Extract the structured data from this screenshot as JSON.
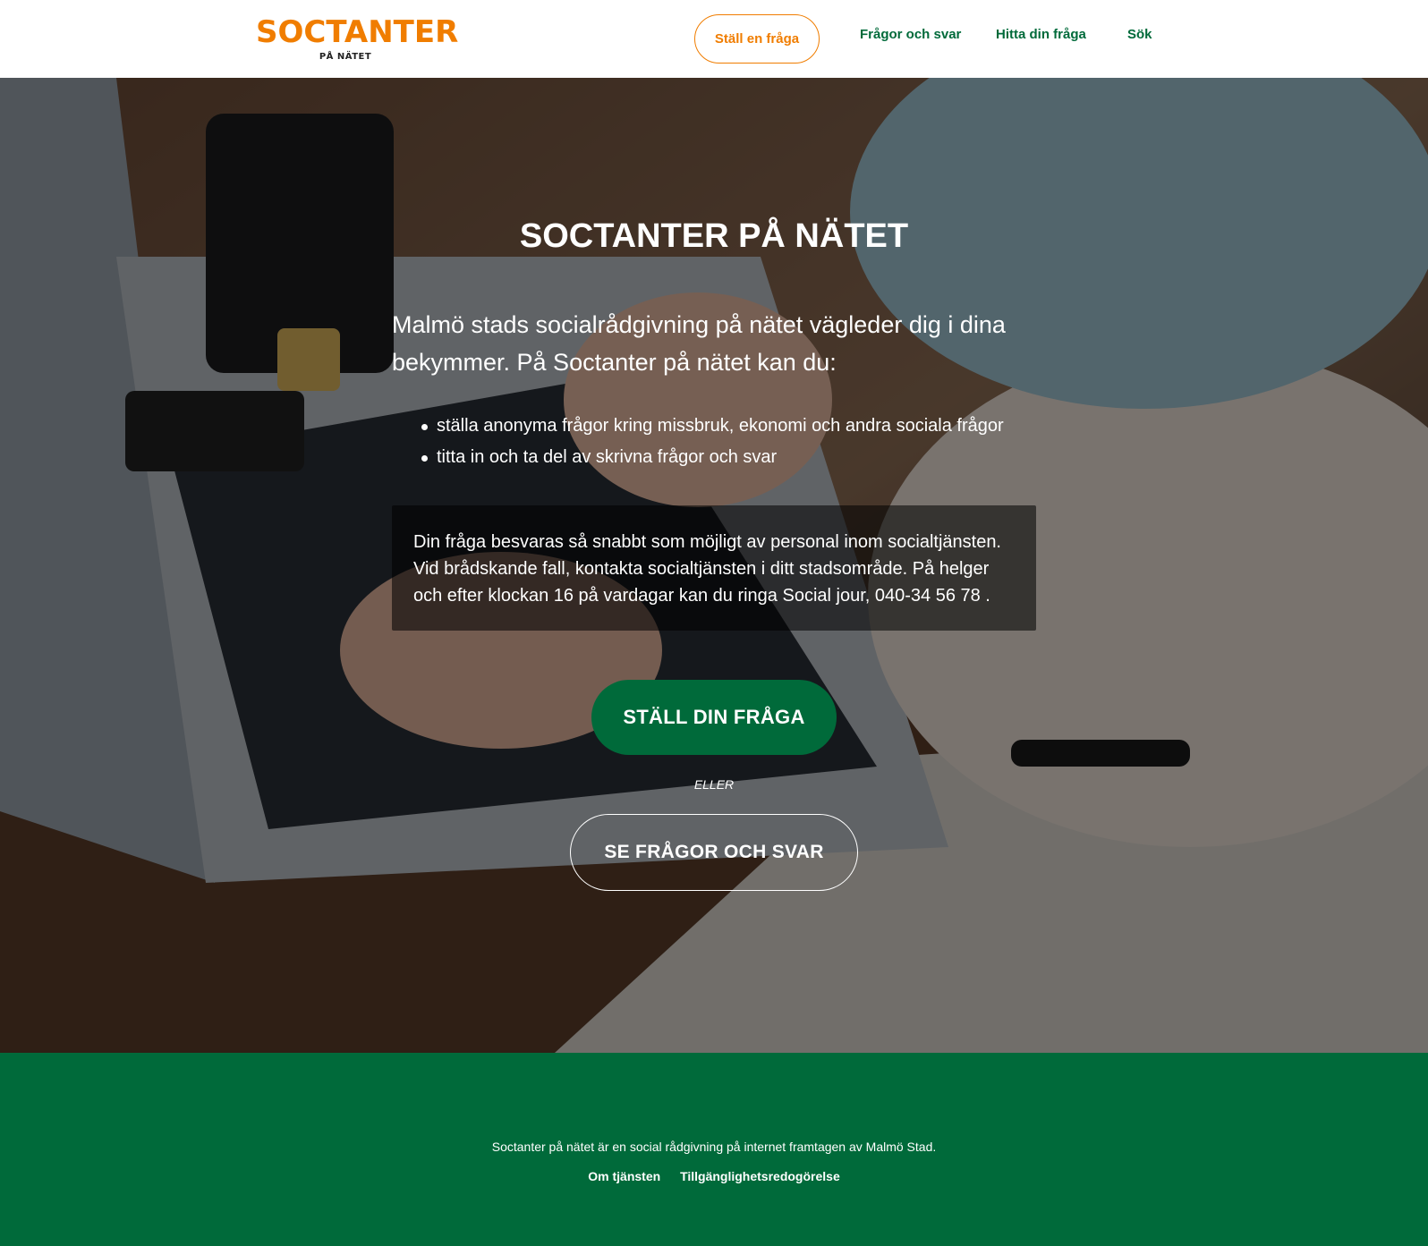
{
  "header": {
    "logo_main": "SOCTANTER",
    "logo_sub": "PÅ NÄTET",
    "cta_label": "Ställ en fråga",
    "nav": [
      "Frågor och svar",
      "Hitta din fråga",
      "Sök"
    ]
  },
  "hero": {
    "title": "SOCTANTER PÅ NÄTET",
    "intro": "Malmö stads socialrådgivning på nätet vägleder dig i dina bekymmer. På Soctanter på nätet kan du:",
    "bullets": [
      "ställa anonyma frågor kring missbruk, ekonomi och andra sociala frågor",
      "titta in och ta del av skrivna frågor och svar"
    ],
    "info": "Din fråga besvaras så snabbt som möjligt av personal inom socialtjänsten. Vid brådskande fall, kontakta socialtjänsten i ditt stadsområde. På helger och efter klockan 16 på vardagar kan du ringa Social jour, 040-34 56 78 .",
    "primary_button": "STÄLL DIN FRÅGA",
    "or_label": "ELLER",
    "secondary_button": "SE FRÅGOR OCH SVAR"
  },
  "footer": {
    "text": "Soctanter på nätet är en social rådgivning på internet framtagen av Malmö Stad.",
    "links": [
      "Om tjänsten",
      "Tillgänglighetsredogörelse"
    ]
  },
  "colors": {
    "brand_orange": "#f07d00",
    "brand_green": "#006a3a"
  }
}
